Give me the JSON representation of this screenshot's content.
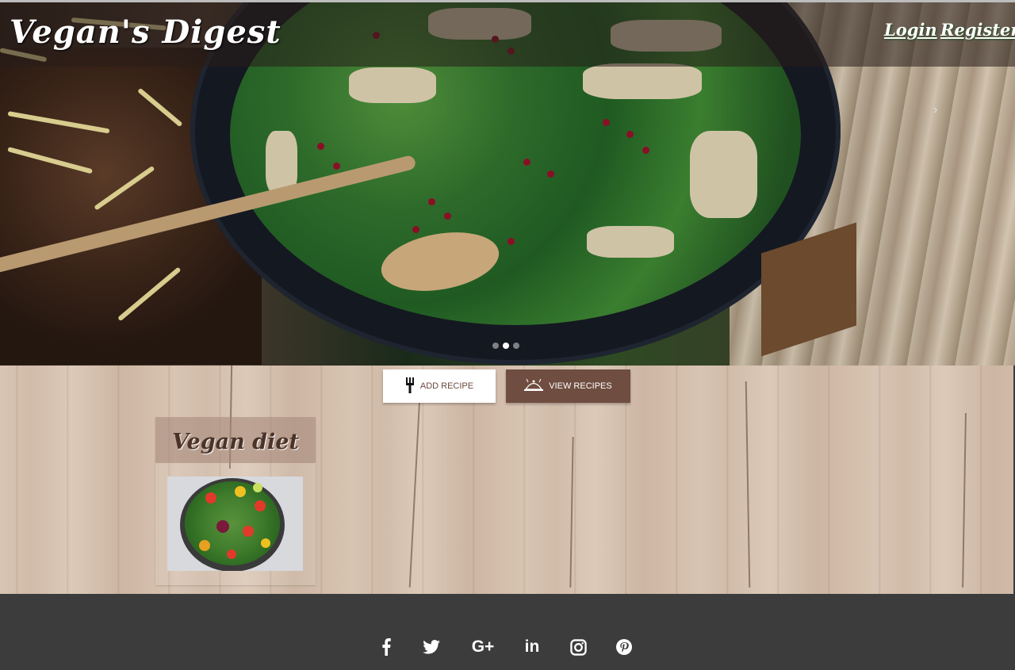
{
  "header": {
    "brand": "Vegan's Digest",
    "nav": {
      "login": "Login",
      "register": "Register"
    }
  },
  "carousel": {
    "next_arrow": "›",
    "indicators": [
      {
        "active": false
      },
      {
        "active": true
      },
      {
        "active": false
      }
    ]
  },
  "actions": {
    "add_recipe": "ADD RECIPE",
    "view_recipes": "VIEW RECIPES"
  },
  "category_card": {
    "title": "Vegan diet"
  },
  "footer": {
    "social": [
      {
        "name": "facebook-icon",
        "glyph": "f"
      },
      {
        "name": "twitter-icon",
        "glyph": "t"
      },
      {
        "name": "google-plus-icon",
        "glyph": "G+"
      },
      {
        "name": "linkedin-icon",
        "glyph": "in"
      },
      {
        "name": "instagram-icon",
        "glyph": "ig"
      },
      {
        "name": "pinterest-icon",
        "glyph": "p"
      }
    ]
  },
  "colors": {
    "brand_brown": "#6f4d40",
    "footer_bg": "#3c3c3c",
    "wood": "#d9c5b4"
  }
}
